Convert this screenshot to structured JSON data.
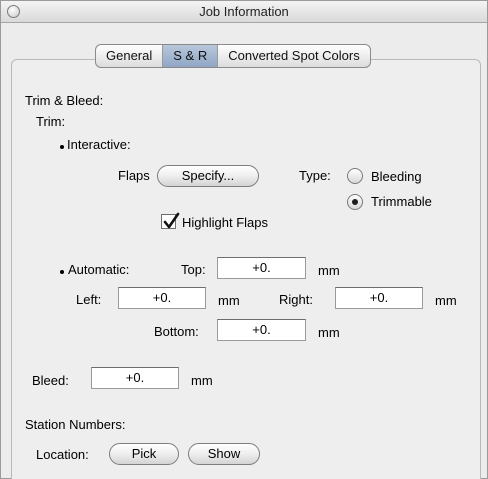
{
  "window": {
    "title": "Job Information"
  },
  "tabs": [
    {
      "label": "General"
    },
    {
      "label": "S & R"
    },
    {
      "label": "Converted Spot Colors"
    }
  ],
  "trim_bleed": {
    "heading": "Trim & Bleed:",
    "trim_label": "Trim:",
    "interactive_label": "Interactive:",
    "flaps_label": "Flaps",
    "specify_button": "Specify...",
    "type_label": "Type:",
    "type_options": [
      {
        "label": "Bleeding",
        "selected": false
      },
      {
        "label": "Trimmable",
        "selected": true
      }
    ],
    "highlight_flaps_label": "Highlight Flaps",
    "highlight_flaps_checked": true,
    "automatic_label": "Automatic:",
    "top_label": "Top:",
    "top_value": "+0.",
    "left_label": "Left:",
    "left_value": "+0.",
    "right_label": "Right:",
    "right_value": "+0.",
    "bottom_label": "Bottom:",
    "bottom_value": "+0.",
    "unit": "mm",
    "bleed_label": "Bleed:",
    "bleed_value": "+0."
  },
  "station_numbers": {
    "heading": "Station Numbers:",
    "location_label": "Location:",
    "pick_button": "Pick",
    "show_button": "Show"
  }
}
